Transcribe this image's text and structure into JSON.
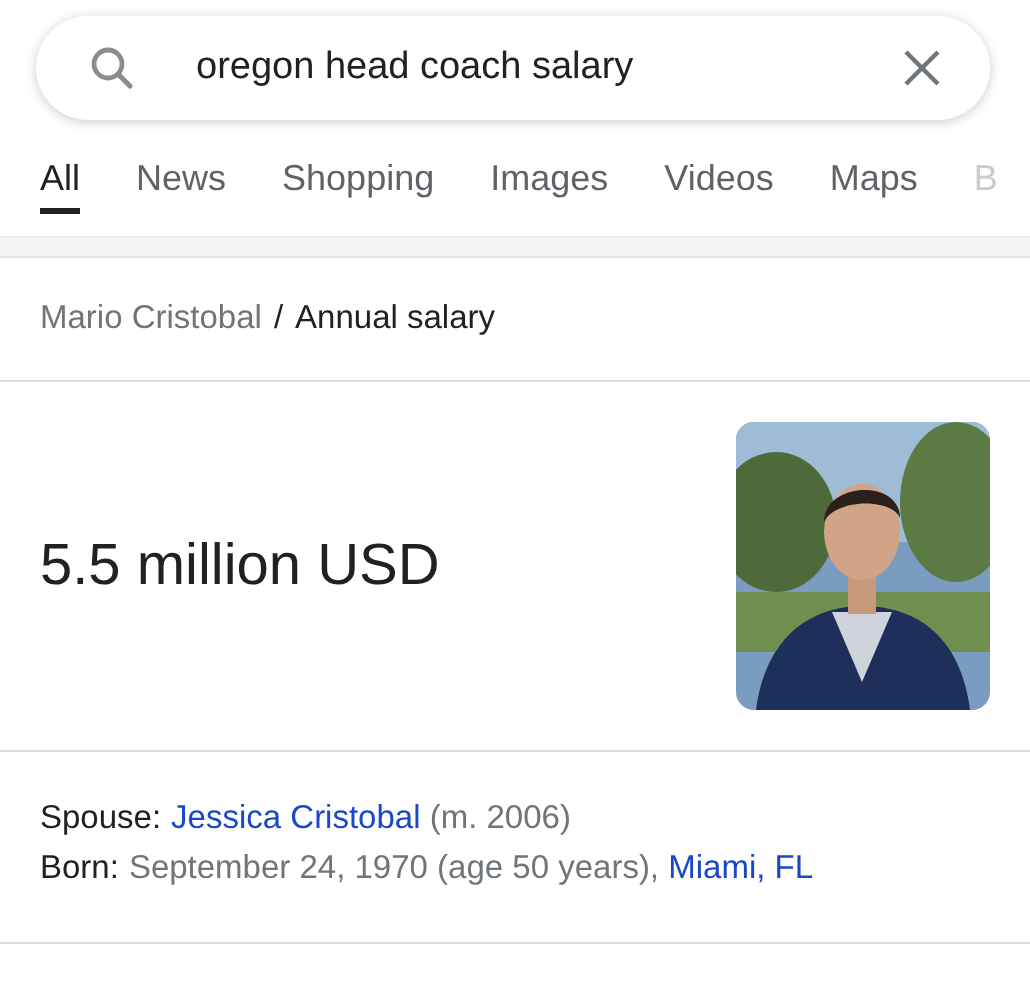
{
  "search": {
    "value": "oregon head coach salary"
  },
  "tabs": [
    {
      "label": "All",
      "selected": true
    },
    {
      "label": "News",
      "selected": false
    },
    {
      "label": "Shopping",
      "selected": false
    },
    {
      "label": "Images",
      "selected": false
    },
    {
      "label": "Videos",
      "selected": false
    },
    {
      "label": "Maps",
      "selected": false
    },
    {
      "label": "B",
      "selected": false
    }
  ],
  "breadcrumb": {
    "entity": "Mario Cristobal",
    "separator": "/",
    "attribute": "Annual salary"
  },
  "answer": {
    "value": "5.5 million USD"
  },
  "facts": [
    {
      "label": "Spouse:",
      "parts": [
        {
          "kind": "link",
          "text": "Jessica Cristobal"
        },
        {
          "kind": "plain",
          "text": " (m. 2006)"
        }
      ]
    },
    {
      "label": "Born:",
      "parts": [
        {
          "kind": "plain",
          "text": "September 24, 1970 (age 50 years), "
        },
        {
          "kind": "link",
          "text": "Miami, FL"
        }
      ]
    }
  ]
}
